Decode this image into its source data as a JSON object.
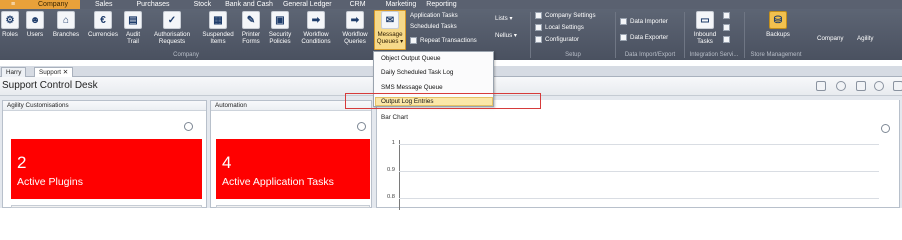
{
  "menubar": {
    "orb": "≡",
    "items": [
      "Company",
      "Sales",
      "Purchases",
      "Stock",
      "Bank and Cash",
      "General Ledger",
      "CRM",
      "Marketing",
      "Reporting"
    ]
  },
  "ribbon": {
    "buttons": [
      {
        "label": "Roles",
        "icon": "roles-icon"
      },
      {
        "label": "Users",
        "icon": "users-icon"
      },
      {
        "label": "Branches",
        "icon": "branches-icon"
      },
      {
        "label": "Currencies",
        "icon": "currencies-icon"
      },
      {
        "label": "Audit\nTrail",
        "icon": "audit-trail-icon"
      },
      {
        "label": "Authorisation\nRequests",
        "icon": "authorisation-icon"
      },
      {
        "label": "Suspended\nItems",
        "icon": "suspended-items-icon"
      },
      {
        "label": "Printer\nForms",
        "icon": "printer-icon"
      },
      {
        "label": "Security\nPolicies",
        "icon": "lock-icon"
      },
      {
        "label": "Workflow\nConditions",
        "icon": "workflow-icon"
      },
      {
        "label": "Workflow\nQueries",
        "icon": "workflow-queries-icon"
      },
      {
        "label": "Message\nQueues ▾",
        "icon": "message-queue-icon"
      }
    ],
    "small_buttons": {
      "application_tasks": "Application Tasks",
      "scheduled_tasks": "Scheduled Tasks",
      "repeat_transactions": "Repeat Transactions",
      "lists": "Lists ▾",
      "nellus": "Nellus ▾",
      "company_settings": "Company Settings",
      "local_settings": "Local Settings",
      "configurator": "Configurator",
      "data_importer": "Data Importer",
      "data_exporter": "Data Exporter"
    },
    "right_buttons": [
      {
        "label": "Inbound\nTasks",
        "icon": "inbound-tasks-icon"
      },
      {
        "label": "Backups",
        "icon": "backups-icon"
      },
      {
        "label": "Company",
        "icon": ""
      },
      {
        "label": "Agility",
        "icon": ""
      }
    ],
    "groups": {
      "company": "Company",
      "setup": "Setup",
      "data": "Data Import/Export",
      "integration": "Integration Servi...",
      "store": "Store Management"
    }
  },
  "tabs": [
    {
      "label": "Harry"
    },
    {
      "label": "Support  ✕"
    }
  ],
  "page": {
    "title": "Support Control Desk"
  },
  "panels": {
    "customisations": {
      "title": "Agility Customisations",
      "tile_value": "2",
      "tile_caption": "Active Plugins"
    },
    "automation": {
      "title": "Automation",
      "tile_value": "4",
      "tile_caption": "Active Application Tasks"
    },
    "chart": {
      "title": "Bar Chart"
    }
  },
  "dropdown": {
    "items": [
      "Object Output Queue",
      "Daily Scheduled Task Log",
      "SMS Message Queue",
      "Output Log Entries"
    ],
    "highlighted_index": 3
  },
  "chart_data": {
    "type": "bar",
    "title": "Bar Chart",
    "categories": [],
    "values": [],
    "yticks": [
      "1",
      "0.9",
      "0.8"
    ],
    "ylim": [
      0.8,
      1
    ],
    "grid": true
  },
  "colors": {
    "tile": "#ff0000",
    "ribbon": "#4a5160",
    "active_tab": "#e8a13a",
    "highlight": "#fbe7a8",
    "annotation": "#d63b3b"
  }
}
